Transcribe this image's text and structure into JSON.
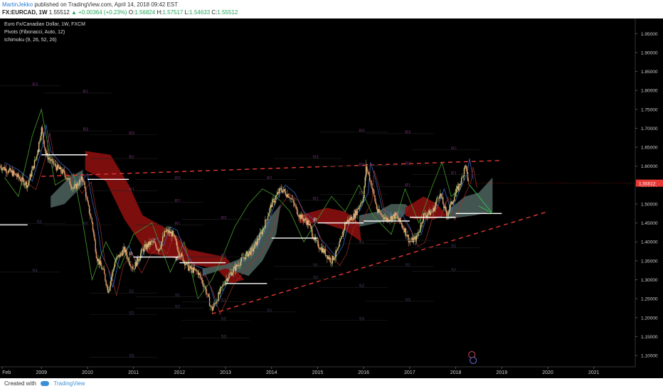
{
  "header": {
    "author": "MartinJekko",
    "published": "published on TradingView.com, April 14, 2018 09:42 EST",
    "symbol": "FX:EURCAD, 1W",
    "price": "1.55512",
    "change": "▲ +0.00364 (+0.23%)",
    "open_label": "O:",
    "open": "1.56824",
    "high_label": "H:",
    "high": "1.57517",
    "low_label": "L:",
    "low": "1.54633",
    "close_label": "C:",
    "close": "1.55512"
  },
  "legend": {
    "series": "Euro Fx/Canadian Dollar, 1W, FXCM",
    "pivots": "Pivots (Fibonacci, Auto, 12)",
    "ichimoku": "Ichimoku (9, 26, 52, 26)"
  },
  "footer": {
    "created_with": "Created with",
    "brand": "TradingView"
  },
  "colors": {
    "background": "#000000",
    "up": "#26a69a",
    "down": "#ef5350",
    "price_label_bg": "#e53935",
    "cloud_bull": "#4a5e5a",
    "cloud_bear": "#8b0f0f",
    "trendline": "#e53935",
    "pivot_line": "#ffffff",
    "lagging": "#3f8f28"
  },
  "chart_data": {
    "type": "line",
    "y_axis": {
      "range": [
        1.07,
        1.99
      ],
      "ticks": [
        "1.95000",
        "1.90000",
        "1.85000",
        "1.80000",
        "1.75000",
        "1.70000",
        "1.65000",
        "1.60000",
        "1.55000",
        "1.50000",
        "1.45000",
        "1.40000",
        "1.35000",
        "1.30000",
        "1.25000",
        "1.20000",
        "1.15000",
        "1.10000"
      ]
    },
    "x_axis": {
      "range": [
        2008.1,
        2021.9
      ],
      "labels": [
        "Feb",
        "2009",
        "2010",
        "2011",
        "2012",
        "2013",
        "2014",
        "2015",
        "2016",
        "2017",
        "2018",
        "2019",
        "2020",
        "2021"
      ]
    },
    "current_price_label": "1.55512",
    "price_path": [
      [
        2008.1,
        1.6
      ],
      [
        2008.4,
        1.58
      ],
      [
        2008.7,
        1.55
      ],
      [
        2008.9,
        1.63
      ],
      [
        2009.0,
        1.7
      ],
      [
        2009.1,
        1.63
      ],
      [
        2009.3,
        1.6
      ],
      [
        2009.5,
        1.58
      ],
      [
        2009.7,
        1.54
      ],
      [
        2009.9,
        1.57
      ],
      [
        2010.0,
        1.5
      ],
      [
        2010.1,
        1.45
      ],
      [
        2010.2,
        1.36
      ],
      [
        2010.35,
        1.32
      ],
      [
        2010.45,
        1.27
      ],
      [
        2010.6,
        1.35
      ],
      [
        2010.8,
        1.38
      ],
      [
        2010.9,
        1.35
      ],
      [
        2011.0,
        1.33
      ],
      [
        2011.2,
        1.38
      ],
      [
        2011.4,
        1.4
      ],
      [
        2011.55,
        1.38
      ],
      [
        2011.7,
        1.43
      ],
      [
        2011.85,
        1.42
      ],
      [
        2012.0,
        1.37
      ],
      [
        2012.2,
        1.33
      ],
      [
        2012.4,
        1.32
      ],
      [
        2012.55,
        1.28
      ],
      [
        2012.7,
        1.22
      ],
      [
        2012.85,
        1.26
      ],
      [
        2013.0,
        1.3
      ],
      [
        2013.2,
        1.33
      ],
      [
        2013.4,
        1.36
      ],
      [
        2013.6,
        1.38
      ],
      [
        2013.8,
        1.43
      ],
      [
        2014.0,
        1.5
      ],
      [
        2014.2,
        1.54
      ],
      [
        2014.4,
        1.52
      ],
      [
        2014.6,
        1.47
      ],
      [
        2014.8,
        1.45
      ],
      [
        2014.95,
        1.4
      ],
      [
        2015.1,
        1.38
      ],
      [
        2015.3,
        1.35
      ],
      [
        2015.45,
        1.38
      ],
      [
        2015.6,
        1.45
      ],
      [
        2015.8,
        1.47
      ],
      [
        2016.0,
        1.52
      ],
      [
        2016.05,
        1.6
      ],
      [
        2016.15,
        1.56
      ],
      [
        2016.3,
        1.48
      ],
      [
        2016.5,
        1.46
      ],
      [
        2016.7,
        1.47
      ],
      [
        2016.9,
        1.43
      ],
      [
        2017.0,
        1.4
      ],
      [
        2017.15,
        1.41
      ],
      [
        2017.3,
        1.47
      ],
      [
        2017.5,
        1.48
      ],
      [
        2017.65,
        1.53
      ],
      [
        2017.8,
        1.47
      ],
      [
        2017.9,
        1.5
      ],
      [
        2018.0,
        1.53
      ],
      [
        2018.15,
        1.57
      ],
      [
        2018.2,
        1.61
      ],
      [
        2018.28,
        1.55512
      ]
    ],
    "ichimoku_cloud": [
      {
        "kind": "bear",
        "path": [
          [
            2009.95,
            1.64
          ],
          [
            2010.5,
            1.63
          ],
          [
            2010.9,
            1.55
          ],
          [
            2011.2,
            1.47
          ],
          [
            2011.8,
            1.43
          ],
          [
            2012.2,
            1.38
          ],
          [
            2012.6,
            1.37
          ],
          [
            2013.0,
            1.36
          ],
          [
            2013.4,
            1.3
          ],
          [
            2013.1,
            1.29
          ],
          [
            2012.8,
            1.33
          ],
          [
            2012.3,
            1.34
          ],
          [
            2011.8,
            1.36
          ],
          [
            2011.3,
            1.37
          ],
          [
            2010.8,
            1.46
          ],
          [
            2010.4,
            1.56
          ],
          [
            2009.95,
            1.59
          ]
        ]
      },
      {
        "kind": "bull",
        "path": [
          [
            2009.2,
            1.52
          ],
          [
            2009.6,
            1.57
          ],
          [
            2009.9,
            1.59
          ],
          [
            2009.9,
            1.55
          ],
          [
            2009.5,
            1.5
          ],
          [
            2009.2,
            1.49
          ]
        ]
      },
      {
        "kind": "bull",
        "path": [
          [
            2012.5,
            1.33
          ],
          [
            2013.0,
            1.34
          ],
          [
            2013.4,
            1.36
          ],
          [
            2013.6,
            1.4
          ],
          [
            2014.0,
            1.47
          ],
          [
            2014.2,
            1.5
          ],
          [
            2014.1,
            1.42
          ],
          [
            2013.8,
            1.35
          ],
          [
            2013.5,
            1.31
          ],
          [
            2013.0,
            1.33
          ],
          [
            2012.5,
            1.31
          ]
        ]
      },
      {
        "kind": "bear",
        "path": [
          [
            2014.6,
            1.47
          ],
          [
            2015.2,
            1.49
          ],
          [
            2015.6,
            1.48
          ],
          [
            2015.9,
            1.45
          ],
          [
            2015.95,
            1.4
          ],
          [
            2015.6,
            1.43
          ],
          [
            2015.1,
            1.45
          ],
          [
            2014.6,
            1.45
          ]
        ]
      },
      {
        "kind": "bull",
        "path": [
          [
            2015.9,
            1.47
          ],
          [
            2016.3,
            1.48
          ],
          [
            2016.6,
            1.5
          ],
          [
            2016.9,
            1.5
          ],
          [
            2017.0,
            1.49
          ],
          [
            2016.8,
            1.46
          ],
          [
            2016.3,
            1.45
          ],
          [
            2015.9,
            1.44
          ]
        ]
      },
      {
        "kind": "bear",
        "path": [
          [
            2016.9,
            1.49
          ],
          [
            2017.3,
            1.52
          ],
          [
            2017.6,
            1.5
          ],
          [
            2017.8,
            1.47
          ],
          [
            2017.5,
            1.46
          ],
          [
            2017.1,
            1.46
          ],
          [
            2016.9,
            1.47
          ]
        ]
      },
      {
        "kind": "bull",
        "path": [
          [
            2017.8,
            1.48
          ],
          [
            2018.2,
            1.52
          ],
          [
            2018.5,
            1.53
          ],
          [
            2018.8,
            1.57
          ],
          [
            2018.8,
            1.48
          ],
          [
            2018.4,
            1.47
          ],
          [
            2017.8,
            1.46
          ]
        ]
      }
    ],
    "lagging_span": [
      [
        2008.2,
        1.57
      ],
      [
        2008.5,
        1.52
      ],
      [
        2008.8,
        1.68
      ],
      [
        2009.0,
        1.75
      ],
      [
        2009.3,
        1.55
      ],
      [
        2009.7,
        1.58
      ],
      [
        2009.9,
        1.45
      ],
      [
        2010.1,
        1.3
      ],
      [
        2010.4,
        1.4
      ],
      [
        2010.7,
        1.33
      ],
      [
        2011.0,
        1.42
      ],
      [
        2011.4,
        1.45
      ],
      [
        2011.8,
        1.32
      ],
      [
        2012.1,
        1.4
      ],
      [
        2012.4,
        1.25
      ],
      [
        2012.7,
        1.3
      ],
      [
        2012.9,
        1.35
      ],
      [
        2013.2,
        1.44
      ],
      [
        2013.5,
        1.5
      ],
      [
        2013.8,
        1.54
      ],
      [
        2014.1,
        1.52
      ],
      [
        2014.4,
        1.48
      ],
      [
        2014.7,
        1.4
      ],
      [
        2015.0,
        1.46
      ],
      [
        2015.3,
        1.52
      ],
      [
        2015.6,
        1.48
      ],
      [
        2015.9,
        1.55
      ],
      [
        2016.2,
        1.47
      ],
      [
        2016.6,
        1.42
      ],
      [
        2016.9,
        1.54
      ],
      [
        2017.2,
        1.45
      ],
      [
        2017.5,
        1.55
      ],
      [
        2017.7,
        1.61
      ],
      [
        2017.9,
        1.52
      ],
      [
        2018.1,
        1.54
      ]
    ],
    "trendlines": [
      {
        "style": "dashed",
        "from": [
          2009.0,
          1.573
        ],
        "to": [
          2019.0,
          1.615
        ]
      },
      {
        "style": "dashed",
        "from": [
          2012.7,
          1.21
        ],
        "to": [
          2020.0,
          1.48
        ]
      }
    ],
    "pivot_p_levels": [
      {
        "from": [
          2008.1,
          1.445
        ],
        "to": [
          2008.7,
          1.445
        ],
        "label": ""
      },
      {
        "from": [
          2009.0,
          1.63
        ],
        "to": [
          2010.0,
          1.63
        ],
        "label": "P"
      },
      {
        "from": [
          2010.0,
          1.565
        ],
        "to": [
          2010.9,
          1.565
        ],
        "label": ""
      },
      {
        "from": [
          2011.0,
          1.36
        ],
        "to": [
          2012.0,
          1.36
        ],
        "label": "P"
      },
      {
        "from": [
          2012.0,
          1.345
        ],
        "to": [
          2013.0,
          1.345
        ],
        "label": "P"
      },
      {
        "from": [
          2013.0,
          1.29
        ],
        "to": [
          2013.9,
          1.29
        ],
        "label": ""
      },
      {
        "from": [
          2014.0,
          1.41
        ],
        "to": [
          2015.0,
          1.41
        ],
        "label": ""
      },
      {
        "from": [
          2015.0,
          1.45
        ],
        "to": [
          2016.0,
          1.45
        ],
        "label": "P"
      },
      {
        "from": [
          2016.0,
          1.455
        ],
        "to": [
          2017.0,
          1.455
        ],
        "label": ""
      },
      {
        "from": [
          2017.0,
          1.465
        ],
        "to": [
          2018.0,
          1.465
        ],
        "label": ""
      },
      {
        "from": [
          2018.0,
          1.475
        ],
        "to": [
          2019.0,
          1.475
        ],
        "label": ""
      }
    ],
    "pivot_labels": [
      {
        "text": "R3",
        "at": [
          2008.8,
          1.812
        ]
      },
      {
        "text": "R1",
        "at": [
          2009.9,
          1.793
        ]
      },
      {
        "text": "R3",
        "at": [
          2009.9,
          1.693
        ]
      },
      {
        "text": "S1",
        "at": [
          2008.9,
          1.449
        ]
      },
      {
        "text": "S2",
        "at": [
          2009.9,
          1.445
        ]
      },
      {
        "text": "S3",
        "at": [
          2008.8,
          1.32
        ]
      },
      {
        "text": "R3",
        "at": [
          2010.9,
          1.683
        ]
      },
      {
        "text": "R2",
        "at": [
          2010.9,
          1.62
        ]
      },
      {
        "text": "R1",
        "at": [
          2010.9,
          1.535
        ]
      },
      {
        "text": "S1",
        "at": [
          2010.9,
          1.265
        ]
      },
      {
        "text": "S2",
        "at": [
          2010.9,
          1.208
        ]
      },
      {
        "text": "S3",
        "at": [
          2010.9,
          1.095
        ]
      },
      {
        "text": "R3",
        "at": [
          2011.9,
          1.565
        ]
      },
      {
        "text": "R2",
        "at": [
          2011.9,
          1.505
        ]
      },
      {
        "text": "R1",
        "at": [
          2011.9,
          1.445
        ]
      },
      {
        "text": "S1",
        "at": [
          2011.9,
          1.255
        ]
      },
      {
        "text": "S2",
        "at": [
          2011.9,
          1.225
        ]
      },
      {
        "text": "R3",
        "at": [
          2012.9,
          1.46
        ]
      },
      {
        "text": "R1",
        "at": [
          2012.9,
          1.36
        ]
      },
      {
        "text": "S1",
        "at": [
          2012.9,
          1.242
        ]
      },
      {
        "text": "S2",
        "at": [
          2012.9,
          1.193
        ]
      },
      {
        "text": "S3",
        "at": [
          2012.9,
          1.146
        ]
      },
      {
        "text": "R1",
        "at": [
          2013.9,
          1.565
        ]
      },
      {
        "text": "S1",
        "at": [
          2013.9,
          1.215
        ]
      },
      {
        "text": "R3",
        "at": [
          2014.9,
          1.62
        ]
      },
      {
        "text": "R1",
        "at": [
          2014.9,
          1.51
        ]
      },
      {
        "text": "S1",
        "at": [
          2014.9,
          1.335
        ]
      },
      {
        "text": "S2",
        "at": [
          2014.9,
          1.302
        ]
      },
      {
        "text": "R3",
        "at": [
          2015.9,
          1.69
        ]
      },
      {
        "text": "R2",
        "at": [
          2015.9,
          1.6
        ]
      },
      {
        "text": "R1",
        "at": [
          2015.9,
          1.525
        ]
      },
      {
        "text": "S1",
        "at": [
          2015.9,
          1.395
        ]
      },
      {
        "text": "S2",
        "at": [
          2015.9,
          1.28
        ]
      },
      {
        "text": "S3",
        "at": [
          2015.9,
          1.193
        ]
      },
      {
        "text": "R3",
        "at": [
          2016.9,
          1.686
        ]
      },
      {
        "text": "R2",
        "at": [
          2016.9,
          1.603
        ]
      },
      {
        "text": "R1",
        "at": [
          2016.9,
          1.546
        ]
      },
      {
        "text": "S1",
        "at": [
          2016.9,
          1.404
        ]
      },
      {
        "text": "S2",
        "at": [
          2016.9,
          1.335
        ]
      },
      {
        "text": "S3",
        "at": [
          2016.9,
          1.243
        ]
      },
      {
        "text": "R2",
        "at": [
          2017.9,
          1.643
        ]
      },
      {
        "text": "R1",
        "at": [
          2017.9,
          1.578
        ]
      },
      {
        "text": "S1",
        "at": [
          2017.9,
          1.385
        ]
      },
      {
        "text": "S2",
        "at": [
          2017.9,
          1.322
        ]
      }
    ]
  }
}
